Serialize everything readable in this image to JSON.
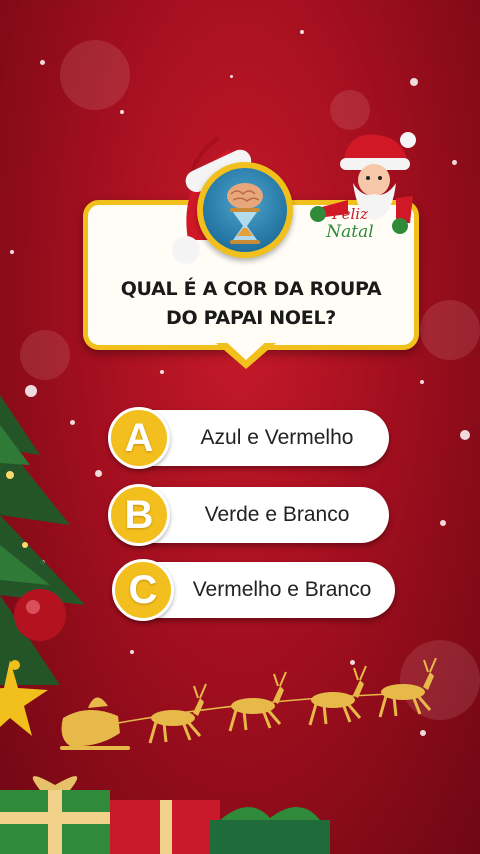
{
  "question": "QUAL É A COR DA ROUPA\nDO PAPAI NOEL?",
  "badge_text": {
    "line1": "Feliz",
    "line2": "Natal"
  },
  "options": [
    {
      "letter": "A",
      "text": "Azul e Vermelho"
    },
    {
      "letter": "B",
      "text": "Verde e Branco"
    },
    {
      "letter": "C",
      "text": "Vermelho e Branco"
    }
  ],
  "icons": [
    "brain-hourglass-icon",
    "santa-hat-icon",
    "santa-claus-icon",
    "christmas-tree-icon",
    "reindeer-sleigh-icon",
    "gift-box-icon"
  ],
  "colors": {
    "background": "#a30f1f",
    "accent": "#f2c01c",
    "card": "#fffdf6"
  }
}
